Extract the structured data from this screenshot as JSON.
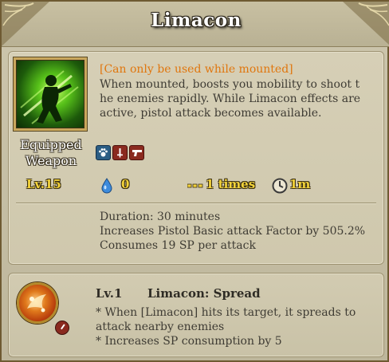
{
  "tooltip": {
    "title": "Limacon",
    "skill": {
      "icon": "gunner-silhouette-icon",
      "equipped_label_line1": "Equipped",
      "equipped_label_line2": "Weapon",
      "restriction": "[Can only be used while mounted]",
      "description_line1": "When mounted, boosts you mobility to shoot t",
      "description_line2": "he enemies rapidly. While Limacon effects are",
      "description_line3": "active, pistol attack becomes available.",
      "badges": [
        "paw-icon",
        "sword-icon",
        "pistol-icon"
      ]
    },
    "stats": {
      "level": "Lv.15",
      "sp_cost": "0",
      "hits": "1 times",
      "cooldown": "1m"
    },
    "effects": [
      "Duration: 30 minutes",
      "Increases Pistol Basic attack Factor by 505.2%",
      "Consumes 19 SP per attack"
    ],
    "attribute": {
      "icon": "spread-attribute-icon",
      "level": "Lv.1",
      "name": "Limacon: Spread",
      "lines": [
        "* When [Limacon] hits its target, it spreads to",
        "attack nearby enemies",
        "* Increases SP consumption by 5"
      ]
    },
    "colors": {
      "title": "#ffffff",
      "restriction": "#e0760e",
      "stat_gold": "#f2d23a",
      "body_text": "#3f3c34",
      "background": "#cdc6ad"
    }
  }
}
